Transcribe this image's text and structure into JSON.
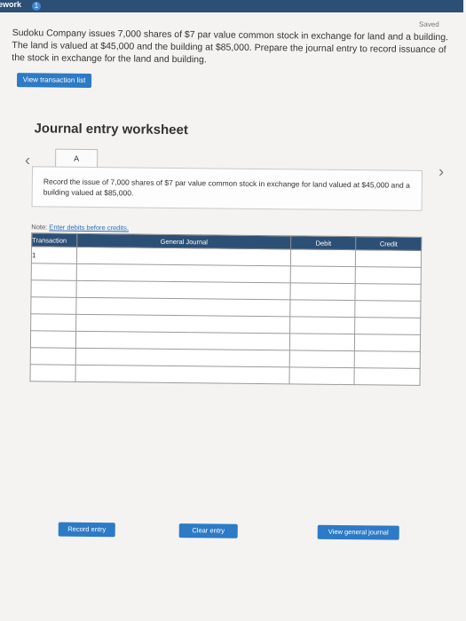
{
  "header": {
    "brand_fragment": "ework",
    "badge": "1"
  },
  "status": {
    "saved": "Saved"
  },
  "question": {
    "text": "Sudoku Company issues 7,000 shares of $7 par value common stock in exchange for land and a building. The land is valued at $45,000 and the building at $85,000. Prepare the journal entry to record issuance of the stock in exchange for the land and building."
  },
  "buttons": {
    "view_transaction_list": "View transaction list",
    "record_entry": "Record entry",
    "clear_entry": "Clear entry",
    "view_general_journal": "View general journal"
  },
  "worksheet": {
    "title": "Journal entry worksheet",
    "tab_label": "A",
    "description": "Record the issue of 7,000 shares of $7 par value common stock in exchange for land valued at $45,000 and a building valued at $85,000.",
    "note_prefix": "Note: ",
    "note_link": "Enter debits before credits."
  },
  "table": {
    "headers": [
      "Transaction",
      "General Journal",
      "Debit",
      "Credit"
    ],
    "rows": [
      [
        "1",
        "",
        "",
        ""
      ],
      [
        "",
        "",
        "",
        ""
      ],
      [
        "",
        "",
        "",
        ""
      ],
      [
        "",
        "",
        "",
        ""
      ],
      [
        "",
        "",
        "",
        ""
      ],
      [
        "",
        "",
        "",
        ""
      ],
      [
        "",
        "",
        "",
        ""
      ],
      [
        "",
        "",
        "",
        ""
      ]
    ]
  }
}
